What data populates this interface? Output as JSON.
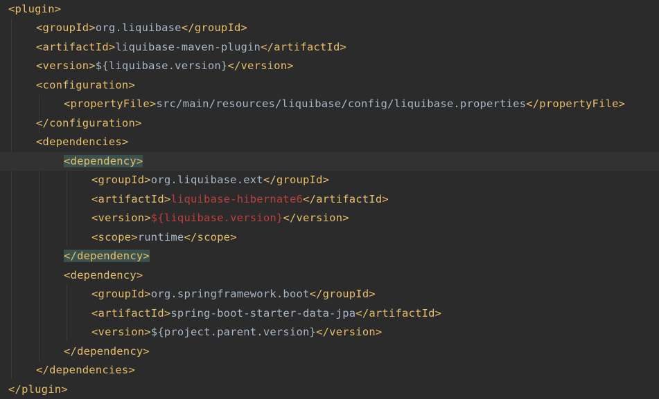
{
  "editor": {
    "language": "xml",
    "current_line": 9,
    "lines": [
      {
        "indent": 0,
        "open": "<plugin>"
      },
      {
        "indent": 1,
        "open": "<groupId>",
        "text": "org.liquibase",
        "close": "</groupId>"
      },
      {
        "indent": 1,
        "open": "<artifactId>",
        "text": "liquibase-maven-plugin",
        "close": "</artifactId>"
      },
      {
        "indent": 1,
        "open": "<version>",
        "text": "${liquibase.version}",
        "close": "</version>"
      },
      {
        "indent": 1,
        "open": "<configuration>"
      },
      {
        "indent": 2,
        "open": "<propertyFile>",
        "text": "src/main/resources/liquibase/config/liquibase.properties",
        "close": "</propertyFile>"
      },
      {
        "indent": 1,
        "open": "</configuration>"
      },
      {
        "indent": 1,
        "open": "<dependencies>"
      },
      {
        "indent": 2,
        "open": "<dependency>",
        "matched": true
      },
      {
        "indent": 3,
        "open": "<groupId>",
        "text": "org.liquibase.ext",
        "close": "</groupId>"
      },
      {
        "indent": 3,
        "open": "<artifactId>",
        "text": "liquibase-hibernate6",
        "close": "</artifactId>",
        "error": true
      },
      {
        "indent": 3,
        "open": "<version>",
        "text": "${liquibase.version}",
        "close": "</version>",
        "error": true
      },
      {
        "indent": 3,
        "open": "<scope>",
        "text": "runtime",
        "close": "</scope>"
      },
      {
        "indent": 2,
        "open": "</dependency>",
        "matched": true
      },
      {
        "indent": 2,
        "open": "<dependency>"
      },
      {
        "indent": 3,
        "open": "<groupId>",
        "text": "org.springframework.boot",
        "close": "</groupId>"
      },
      {
        "indent": 3,
        "open": "<artifactId>",
        "text": "spring-boot-starter-data-jpa",
        "close": "</artifactId>"
      },
      {
        "indent": 3,
        "open": "<version>",
        "text": "${project.parent.version}",
        "close": "</version>"
      },
      {
        "indent": 2,
        "open": "</dependency>"
      },
      {
        "indent": 1,
        "open": "</dependencies>"
      },
      {
        "indent": 0,
        "open": "</plugin>"
      }
    ]
  },
  "colors": {
    "background": "#2b2b2b",
    "current_line": "#323232",
    "tag": "#e8bf6a",
    "text": "#a9b7c6",
    "error": "#bc3f3c",
    "tag_match_highlight": "#3b514d",
    "indent_guide": "#3b3b3b"
  }
}
